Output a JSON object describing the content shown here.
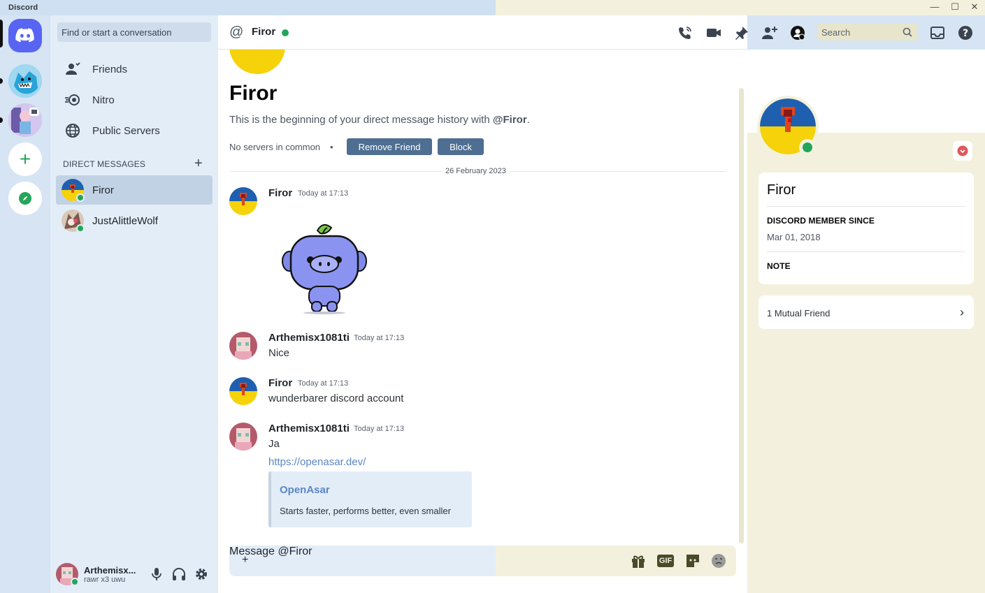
{
  "window": {
    "app_name": "Discord",
    "minimize": "—",
    "maximize": "☐",
    "close": "✕"
  },
  "sidebar": {
    "search_placeholder": "Find or start a conversation",
    "nav": [
      {
        "label": "Friends",
        "icon": "friends-icon"
      },
      {
        "label": "Nitro",
        "icon": "nitro-icon"
      },
      {
        "label": "Public Servers",
        "icon": "globe-icon"
      }
    ],
    "dm_header": "DIRECT MESSAGES",
    "dms": [
      {
        "label": "Firor",
        "active": true,
        "status": "online"
      },
      {
        "label": "JustAlittleWolf",
        "active": false,
        "status": "online"
      }
    ]
  },
  "user_panel": {
    "name": "Arthemisx...",
    "status_text": "rawr x3 uwu"
  },
  "header": {
    "channel_name": "Firor",
    "search_placeholder": "Search"
  },
  "intro": {
    "name": "Firor",
    "subtitle_prefix": "This is the beginning of your direct message history with ",
    "subtitle_handle": "@Firor",
    "subtitle_suffix": ".",
    "common": "No servers in common",
    "bullet": "•",
    "remove_friend": "Remove Friend",
    "block": "Block"
  },
  "date_divider": "26 February 2023",
  "messages": [
    {
      "author": "Firor",
      "time": "Today at 17:13",
      "text": ""
    },
    {
      "author": "Arthemisx1081ti",
      "time": "Today at 17:13",
      "text": "Nice"
    },
    {
      "author": "Firor",
      "time": "Today at 17:13",
      "text": "wunderbarer discord account"
    },
    {
      "author": "Arthemisx1081ti",
      "time": "Today at 17:13",
      "text": "Ja",
      "link": "https://openasar.dev/"
    }
  ],
  "embed": {
    "title": "OpenAsar",
    "description": "Starts faster, performs better, even smaller"
  },
  "composer": {
    "placeholder": "Message @Firor",
    "gif_label": "GIF"
  },
  "profile": {
    "username": "Firor",
    "member_since_label": "DISCORD MEMBER SINCE",
    "member_since": "Mar 01, 2018",
    "note_label": "NOTE",
    "mutual": "1 Mutual Friend"
  },
  "colors": {
    "online": "#23a55a",
    "accent": "#5865f2",
    "button": "#4e6e92",
    "link": "#5b87c3"
  }
}
